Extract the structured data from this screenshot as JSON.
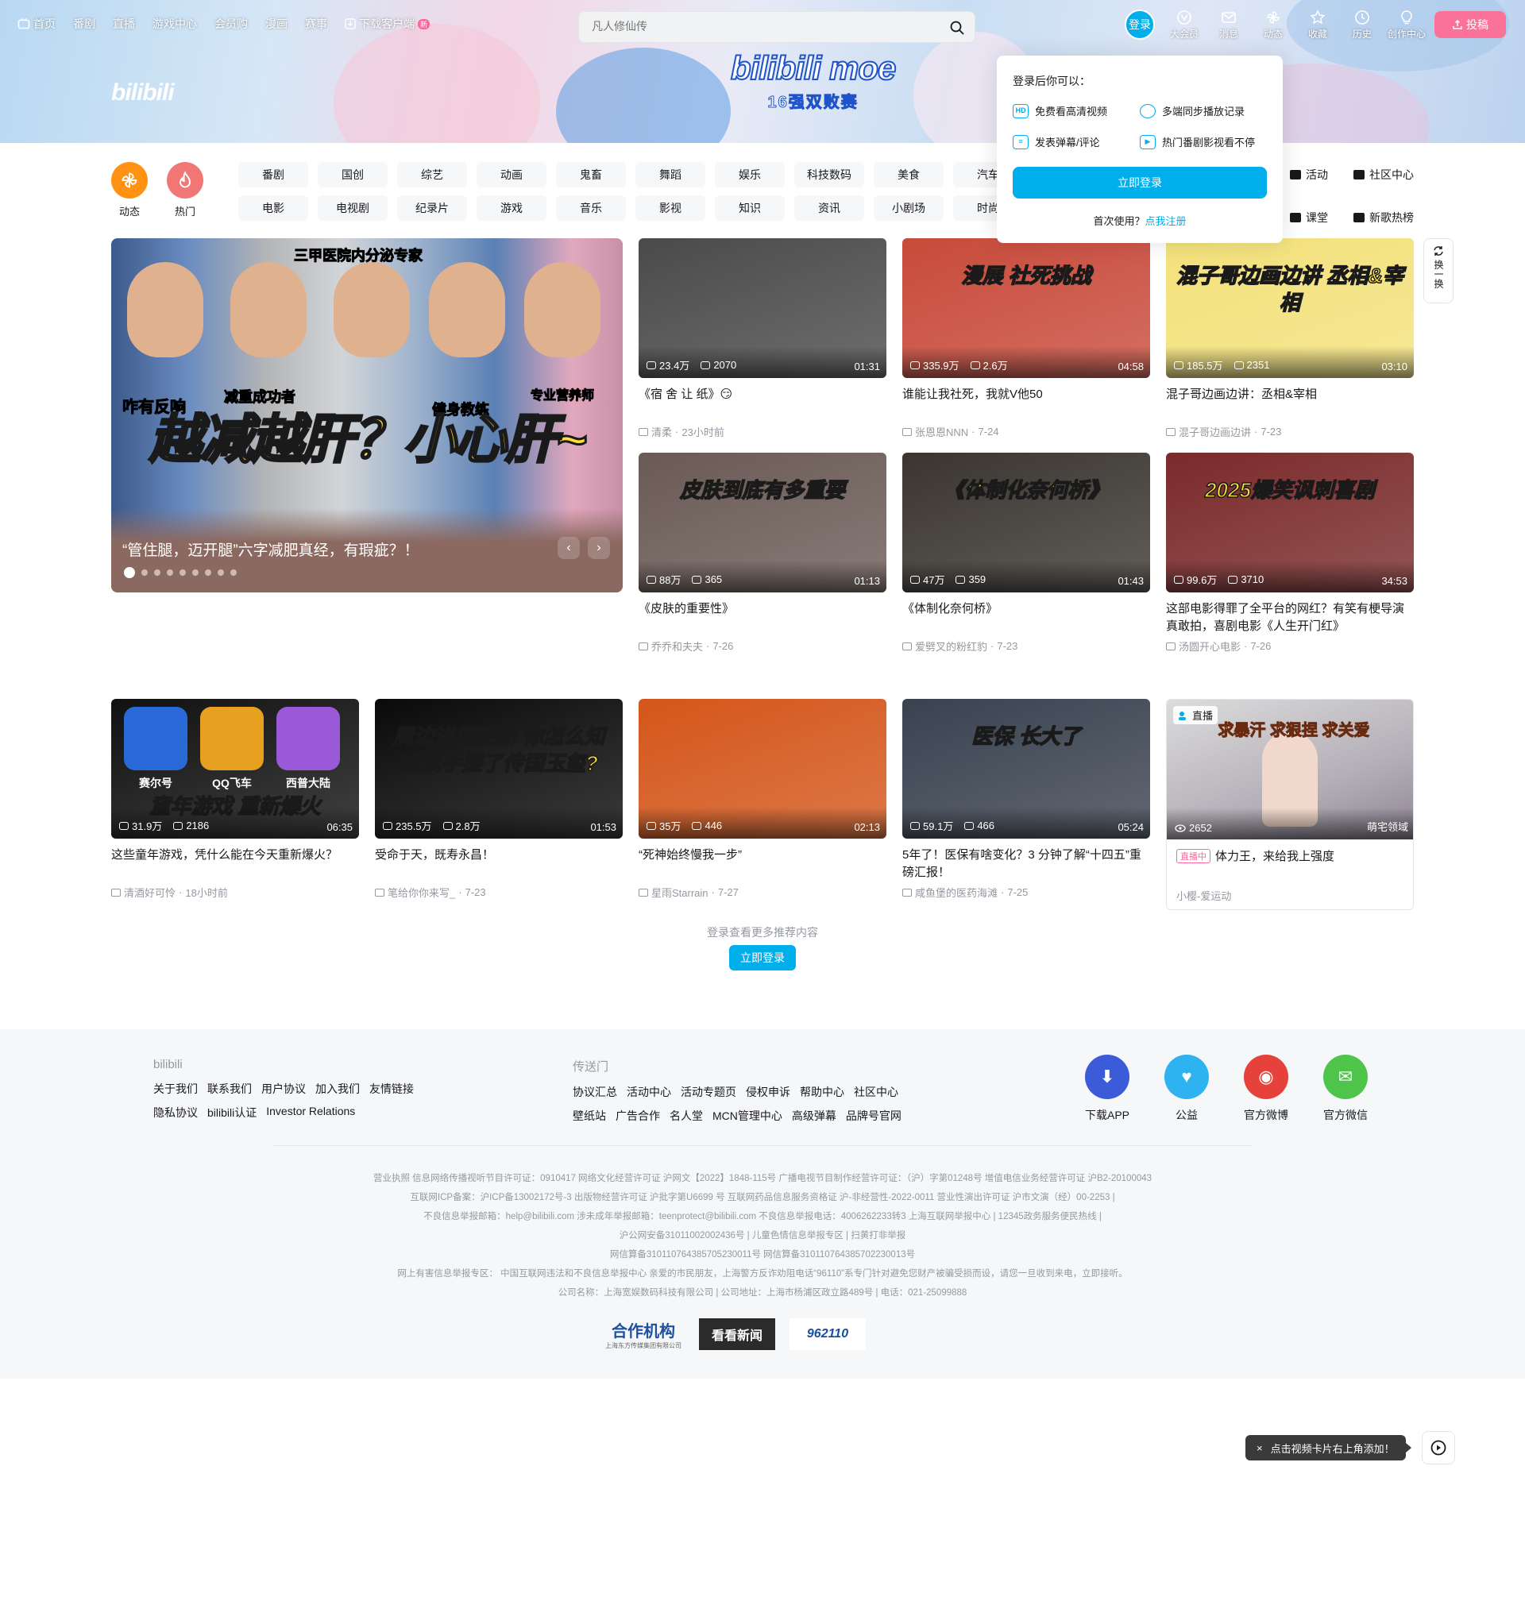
{
  "nav": {
    "left": [
      "首页",
      "番剧",
      "直播",
      "游戏中心",
      "会员购",
      "漫画",
      "赛事",
      "下载客户端"
    ],
    "download_badge": "新",
    "search_placeholder": "凡人修仙传",
    "login": "登录",
    "right": [
      "大会员",
      "消息",
      "动态",
      "收藏",
      "历史",
      "创作中心"
    ],
    "upload": "投稿"
  },
  "banner": {
    "logo": "bilibili",
    "moe_title": "bilibili moe",
    "moe_subtitle": "16强双败赛"
  },
  "login_popup": {
    "heading": "登录后你可以：",
    "items": [
      {
        "icon": "hd-icon",
        "label": "免费看高清视频"
      },
      {
        "icon": "clock-icon",
        "label": "多端同步播放记录"
      },
      {
        "icon": "danmaku-icon",
        "label": "发表弹幕/评论"
      },
      {
        "icon": "play-icon",
        "label": "热门番剧影视看不停"
      }
    ],
    "button": "立即登录",
    "first_use": "首次使用？",
    "register": "点我注册"
  },
  "channels": {
    "circles": [
      {
        "label": "动态",
        "color": "#ff9212"
      },
      {
        "label": "热门",
        "color": "#f07775"
      }
    ],
    "grid": [
      "番剧",
      "国创",
      "综艺",
      "动画",
      "鬼畜",
      "舞蹈",
      "娱乐",
      "科技数码",
      "美食",
      "汽车",
      "电影",
      "电视剧",
      "纪录片",
      "游戏",
      "音乐",
      "影视",
      "知识",
      "资讯",
      "小剧场",
      "时尚"
    ],
    "right": [
      "活动",
      "社区中心",
      "课堂",
      "新歌热榜"
    ]
  },
  "hero": {
    "caption": "“管住腿，迈开腿”六字减肥真经，有瑕疵？！",
    "overlay_text": "越减越肝？小心肝~",
    "labels": [
      "三甲医院内分泌专家",
      "咋有反响",
      "减重成功者",
      "健身教练",
      "专业营养师"
    ],
    "dot_count": 9,
    "active_dot": 0
  },
  "swap": {
    "label": "换一换"
  },
  "videos": [
    {
      "views": "23.4万",
      "danmaku": "2070",
      "duration": "01:31",
      "title": "《宿 舍 让 纸》😏",
      "author": "清柔",
      "date": "23小时前",
      "thumb": "#4a4a4a"
    },
    {
      "views": "335.9万",
      "danmaku": "2.6万",
      "duration": "04:58",
      "title": "谁能让我社死，我就V他50",
      "author": "张恩恩NNN",
      "date": "7-24",
      "thumb": "#c84a3a",
      "thumb_text": "漫展 社死挑战"
    },
    {
      "views": "185.5万",
      "danmaku": "2351",
      "duration": "03:10",
      "title": "混子哥边画边讲：丞相&宰相",
      "author": "混子哥边画边讲",
      "date": "7-23",
      "thumb": "#f3e17a",
      "thumb_text": "混子哥边画边讲 丞相&宰相"
    },
    {
      "views": "88万",
      "danmaku": "365",
      "duration": "01:13",
      "title": "《皮肤的重要性》",
      "author": "乔乔和夫夫",
      "date": "7-26",
      "thumb": "#6a5a55",
      "thumb_text": "皮肤到底有多重要"
    },
    {
      "views": "47万",
      "danmaku": "359",
      "duration": "01:43",
      "title": "《体制化奈何桥》",
      "author": "爱劈叉的粉红豹",
      "date": "7-23",
      "thumb": "#3a3530",
      "thumb_text": "《体制化奈何桥》"
    },
    {
      "views": "99.6万",
      "danmaku": "3710",
      "duration": "34:53",
      "title": "这部电影得罪了全平台的网红？有笑有梗导演真敢拍，喜剧电影《人生开门红》",
      "author": "汤圆开心电影",
      "date": "7-26",
      "thumb": "#7a2a2a",
      "thumb_text": "2025爆笑讽刺喜剧"
    },
    {
      "views": "31.9万",
      "danmaku": "2186",
      "duration": "06:35",
      "title": "这些童年游戏，凭什么能在今天重新爆火？",
      "author": "清酒好可怜",
      "date": "18小时前",
      "thumb": "#111111",
      "thumb_text": "童年游戏 重新爆火",
      "games": [
        "赛尔号",
        "QQ飞车",
        "西普大陆"
      ]
    },
    {
      "views": "235.5万",
      "danmaku": "2.8万",
      "duration": "01:53",
      "title": "受命于天，既寿永昌！",
      "author": "笔给你你来写_",
      "date": "7-23",
      "thumb": "#0a0a0a",
      "thumb_text": "周边进度更新 你怎么知道我手搓了传国玉玺?"
    },
    {
      "views": "35万",
      "danmaku": "446",
      "duration": "02:13",
      "title": "“死神始终慢我一步”",
      "author": "星雨Starrain",
      "date": "7-27",
      "thumb": "#d4561a"
    },
    {
      "views": "59.1万",
      "danmaku": "466",
      "duration": "05:24",
      "title": "5年了！医保有啥变化？3 分钟了解“十四五”重磅汇报！",
      "author": "咸鱼堡的医药海滩",
      "date": "7-25",
      "thumb": "#3a4250",
      "thumb_text": "医保 长大了"
    }
  ],
  "live": {
    "tag": "直播",
    "viewers": "2652",
    "area": "萌宅领域",
    "badge": "直播中",
    "title": "体力王，来给我上强度",
    "author": "小樱-爱运动",
    "thumb_text": "求暴汗 求狠捏 求关爱"
  },
  "more": {
    "text": "登录查看更多推荐内容",
    "button": "立即登录"
  },
  "footer": {
    "col1_title": "bilibili",
    "col1_row1": [
      "关于我们",
      "联系我们",
      "用户协议",
      "加入我们",
      "友情链接"
    ],
    "col1_row2": [
      "隐私协议",
      "bilibili认证",
      "Investor Relations"
    ],
    "col2_title": "传送门",
    "col2_row1": [
      "协议汇总",
      "活动中心",
      "活动专题页",
      "侵权申诉",
      "帮助中心",
      "社区中心"
    ],
    "col2_row2": [
      "壁纸站",
      "广告合作",
      "名人堂",
      "MCN管理中心",
      "高级弹幕",
      "品牌号官网"
    ],
    "icons": [
      {
        "label": "下载APP",
        "color": "#3c5bd8"
      },
      {
        "label": "公益",
        "color": "#2eb2f0"
      },
      {
        "label": "官方微博",
        "color": "#e6423b"
      },
      {
        "label": "官方微信",
        "color": "#4fc44a"
      }
    ],
    "license_lines": [
      "营业执照   信息网络传播视听节目许可证：0910417   网络文化经营许可证 沪网文【2022】1848-115号   广播电视节目制作经营许可证：（沪）字第01248号   增值电信业务经营许可证 沪B2-20100043",
      "互联网ICP备案：沪ICP备13002172号-3   出版物经营许可证 沪批字第U6699 号   互联网药品信息服务资格证 沪-非经营性-2022-0011   营业性演出许可证 沪市文演（经）00-2253 |",
      "不良信息举报邮箱：help@bilibili.com   涉未成年举报邮箱：teenprotect@bilibili.com   不良信息举报电话：4006262233转3   上海互联网举报中心 |   12345政务服务便民热线 |",
      "沪公网安备31011002002436号 |   儿童色情信息举报专区 |   扫黄打非举报",
      "网信算备310110764385705230011号   网信算备310110764385702230013号",
      "网上有害信息举报专区：   中国互联网违法和不良信息举报中心   亲爱的市民朋友，上海警方反诈劝阻电话“96110”系专门针对避免您财产被骗受损而设，请您一旦收到来电，立即接听。",
      "公司名称：上海宽娱数码科技有限公司 |   公司地址：上海市杨浦区政立路489号 |   电话：021-25099888"
    ],
    "partners": [
      "合作机构",
      "看看新闻",
      "962110"
    ],
    "partner_sub": "上海东方传媒集团有限公司"
  },
  "tooltip": {
    "close": "×",
    "text": "点击视频卡片右上角添加！"
  }
}
